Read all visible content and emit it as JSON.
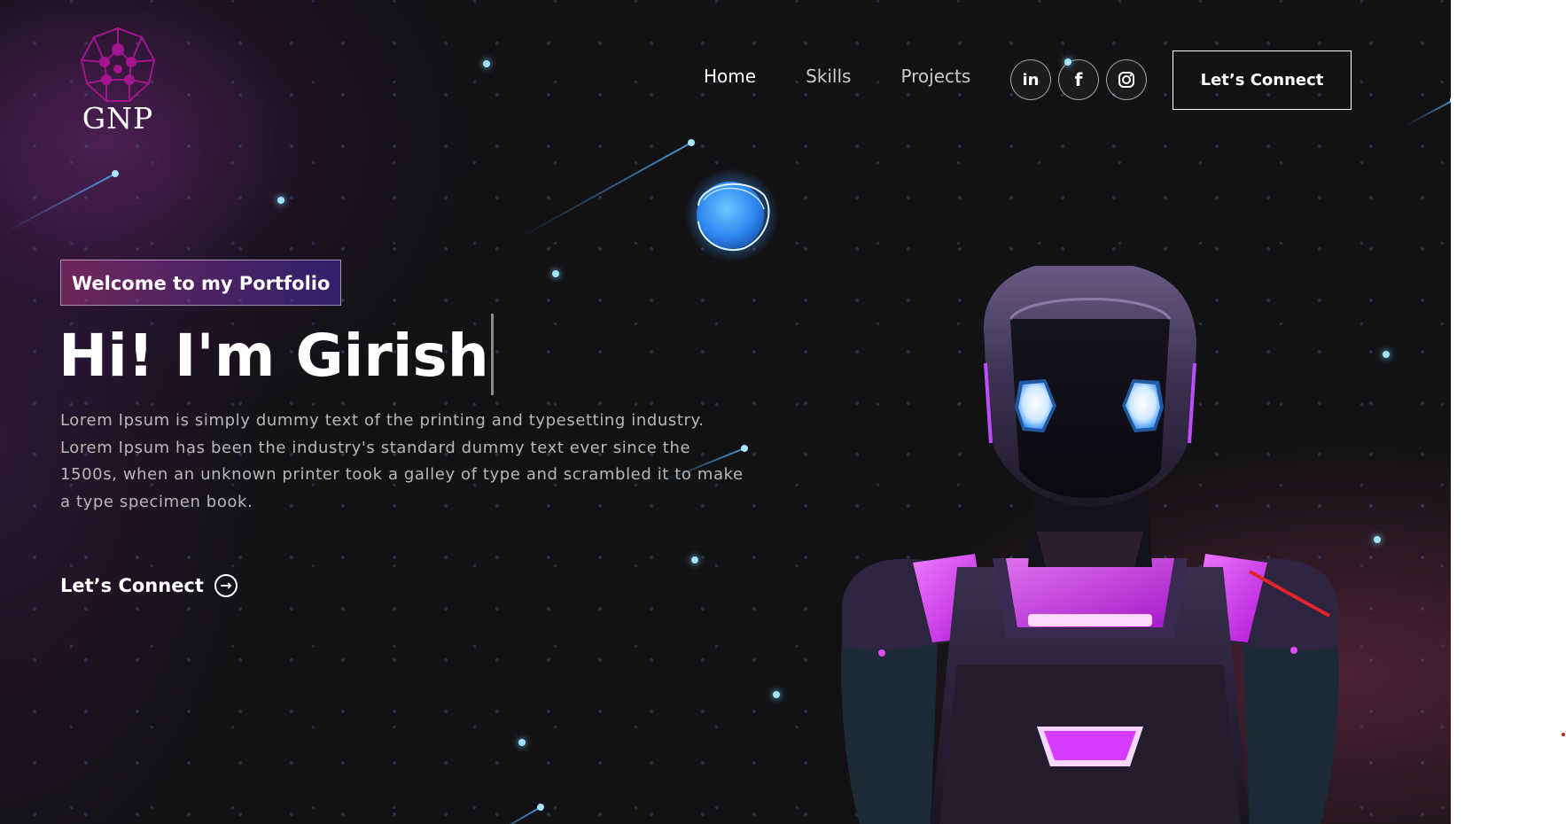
{
  "brand": {
    "logo_text": "GNP",
    "logo_color": "#a3148f"
  },
  "nav": {
    "links": [
      {
        "label": "Home",
        "active": true
      },
      {
        "label": "Skills",
        "active": false
      },
      {
        "label": "Projects",
        "active": false
      }
    ],
    "social": [
      {
        "icon": "linkedin-icon",
        "glyph": "in"
      },
      {
        "icon": "facebook-icon",
        "glyph": "f"
      },
      {
        "icon": "instagram-icon",
        "glyph": ""
      }
    ],
    "connect_label": "Let’s Connect"
  },
  "hero": {
    "tagline": "Welcome to my Portfolio",
    "headline": "Hi! I'm Girish",
    "intro": "Lorem Ipsum is simply dummy text of the printing and typesetting industry. Lorem Ipsum has been the industry's standard dummy text ever since the 1500s, when an unknown printer took a galley of type and scrambled it to make a type specimen book.",
    "connect_label": "Let’s Connect",
    "connect_icon": "arrow-right-circle-icon"
  },
  "colors": {
    "background": "#121214",
    "tagline_gradient_start": "#aa367c",
    "tagline_gradient_end": "#4a2fbd",
    "star": "#9fe3ff",
    "robot_glow": "#e14bff"
  }
}
